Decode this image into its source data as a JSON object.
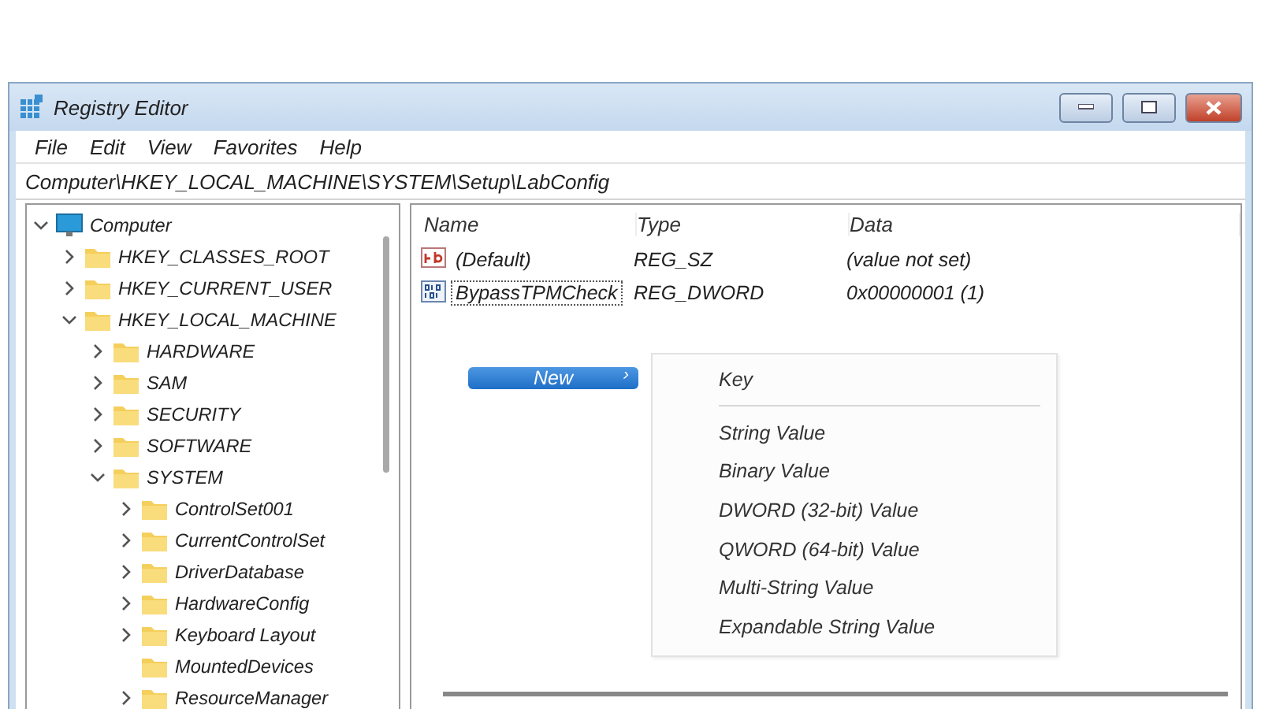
{
  "window": {
    "title": "Registry Editor"
  },
  "menu_bar": [
    "File",
    "Edit",
    "View",
    "Favorites",
    "Help"
  ],
  "address_bar": "Computer\\HKEY_LOCAL_MACHINE\\SYSTEM\\Setup\\LabConfig",
  "tree": [
    {
      "label": "Computer",
      "kind": "computer",
      "expanded": true,
      "children": [
        {
          "label": "HKEY_CLASSES_ROOT",
          "kind": "folder",
          "expanded": false
        },
        {
          "label": "HKEY_CURRENT_USER",
          "kind": "folder",
          "expanded": false
        },
        {
          "label": "HKEY_LOCAL_MACHINE",
          "kind": "folder",
          "expanded": true,
          "children": [
            {
              "label": "HARDWARE",
              "kind": "folder",
              "expanded": false
            },
            {
              "label": "SAM",
              "kind": "folder",
              "expanded": false
            },
            {
              "label": "SECURITY",
              "kind": "folder",
              "expanded": false
            },
            {
              "label": "SOFTWARE",
              "kind": "folder",
              "expanded": false
            },
            {
              "label": "SYSTEM",
              "kind": "folder",
              "expanded": true,
              "children": [
                {
                  "label": "ControlSet001",
                  "kind": "folder",
                  "expanded": false
                },
                {
                  "label": "CurrentControlSet",
                  "kind": "folder",
                  "expanded": false
                },
                {
                  "label": "DriverDatabase",
                  "kind": "folder",
                  "expanded": false
                },
                {
                  "label": "HardwareConfig",
                  "kind": "folder",
                  "expanded": false
                },
                {
                  "label": "Keyboard Layout",
                  "kind": "folder",
                  "expanded": false
                },
                {
                  "label": "MountedDevices",
                  "kind": "folder"
                },
                {
                  "label": "ResourceManager",
                  "kind": "folder",
                  "expanded": false
                }
              ]
            }
          ]
        }
      ]
    }
  ],
  "values_table": {
    "columns": [
      "Name",
      "Type",
      "Data"
    ],
    "rows": [
      {
        "name": "(Default)",
        "kind": "string",
        "type": "REG_SZ",
        "data": "(value not set)",
        "focused": false
      },
      {
        "name": "BypassTPMCheck",
        "kind": "binary",
        "type": "REG_DWORD",
        "data": "0x00000001 (1)",
        "focused": true
      }
    ]
  },
  "context_menu": {
    "items": [
      {
        "label": "New",
        "selected": true,
        "arrow": "›"
      }
    ]
  },
  "submenu": {
    "items": [
      {
        "kind": "item",
        "label": "Key"
      },
      {
        "kind": "separator"
      },
      {
        "kind": "item",
        "label": "String Value"
      },
      {
        "kind": "item",
        "label": "Binary Value"
      },
      {
        "kind": "item",
        "label": "DWORD (32-bit) Value"
      },
      {
        "kind": "item",
        "label": "QWORD (64-bit) Value"
      },
      {
        "kind": "item",
        "label": "Multi-String Value"
      },
      {
        "kind": "item",
        "label": "Expandable String Value"
      }
    ]
  }
}
